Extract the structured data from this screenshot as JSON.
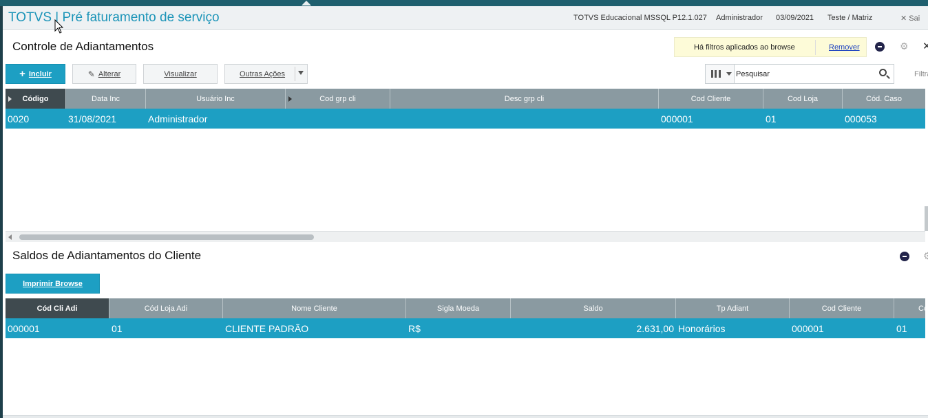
{
  "app": {
    "title": "TOTVS | Pré faturamento de serviço",
    "environment": "TOTVS Educacional MSSQL P12.1.027",
    "user": "Administrador",
    "date": "03/09/2021",
    "branch": "Teste / Matriz",
    "exit_label": "Sai"
  },
  "section1": {
    "title": "Controle de Adiantamentos",
    "filter_notice": "Há filtros aplicados ao browse",
    "remove_label": "Remover",
    "buttons": {
      "incluir": "Incluir",
      "alterar": "Alterar",
      "visualizar": "Visualizar",
      "outras_acoes": "Outras Ações"
    },
    "search": {
      "placeholder": "Pesquisar"
    },
    "filter_label": "Filtra",
    "columns": [
      "Código",
      "Data Inc",
      "Usuário Inc",
      "Cod grp cli",
      "Desc grp cli",
      "Cod Cliente",
      "Cod Loja",
      "Cód. Caso"
    ],
    "rows": [
      [
        "0020",
        "31/08/2021",
        "Administrador",
        "",
        "",
        "000001",
        "01",
        "000053"
      ]
    ]
  },
  "section2": {
    "title": "Saldos de Adiantamentos do Cliente",
    "print_button": "Imprimir Browse",
    "columns": [
      "Cód Cli Adi",
      "Cód Loja Adi",
      "Nome Cliente",
      "Sigla Moeda",
      "Saldo",
      "Tp Adiant",
      "Cod Cliente",
      "Cc"
    ],
    "rows": [
      [
        "000001",
        "01",
        "CLIENTE PADRÃO",
        "R$",
        "2.631,00",
        "Honorários",
        "000001",
        "01"
      ]
    ]
  },
  "colors": {
    "accent": "#1d9fc3",
    "header": "#8a9aa1",
    "active_header": "#3f4a4f",
    "title": "#1b94b8"
  }
}
